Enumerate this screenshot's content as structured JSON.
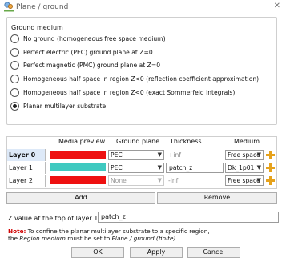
{
  "window": {
    "title": "Plane / ground",
    "close_glyph": "✕"
  },
  "ground_medium": {
    "label": "Ground medium",
    "options": [
      {
        "label": "No ground (homogeneous free space medium)",
        "checked": false
      },
      {
        "label": "Perfect electric (PEC) ground plane at Z=0",
        "checked": false
      },
      {
        "label": "Perfect magnetic (PMC) ground plane at Z=0",
        "checked": false
      },
      {
        "label": "Homogeneous half space in region Z<0 (reflection coefficient approximation)",
        "checked": false
      },
      {
        "label": "Homogeneous half space in region Z<0 (exact Sommerfeld integrals)",
        "checked": false
      },
      {
        "label": "Planar multilayer substrate",
        "checked": true
      }
    ]
  },
  "layers_table": {
    "headers": {
      "media_preview": "Media preview",
      "ground_plane": "Ground plane",
      "thickness": "Thickness",
      "medium": "Medium"
    },
    "rows": [
      {
        "name": "Layer 0",
        "preview_color": "#ee1111",
        "ground_plane": "PEC",
        "thickness": "+inf",
        "medium": "Free space",
        "selected": true
      },
      {
        "name": "Layer 1",
        "preview_color": "#3fc9c0",
        "ground_plane": "PEC",
        "thickness": "patch_z",
        "medium": "Dk_1p01",
        "selected": false
      },
      {
        "name": "Layer 2",
        "preview_color": "#ee1111",
        "ground_plane": "None",
        "thickness": "-inf",
        "medium": "Free space",
        "selected": false
      }
    ]
  },
  "buttons": {
    "add": "Add",
    "remove": "Remove",
    "ok": "OK",
    "apply": "Apply",
    "cancel": "Cancel"
  },
  "z_value": {
    "label": "Z value at the top of layer 1",
    "value": "patch_z"
  },
  "note": {
    "label": "Note:",
    "text1": " To confine the planar multilayer substrate to a specific region,",
    "text2a": "the ",
    "region_term": "Region medium",
    "text2b": " must be set to ",
    "setting_term": "Plane / ground (finite)",
    "text2c": "."
  },
  "colors": {
    "accent_red": "#ee1111",
    "layer1_teal": "#3fc9c0",
    "note_red": "#d00000",
    "selection": "#dde9f8"
  },
  "icons": {
    "title": "plane-ground-icon",
    "medium_add": "plus-icon"
  }
}
